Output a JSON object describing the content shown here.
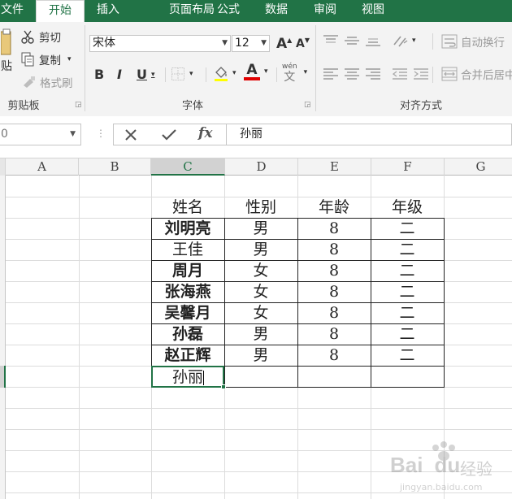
{
  "ribbon_tabs": [
    {
      "label": "文件",
      "active": false
    },
    {
      "label": "开始",
      "active": true
    },
    {
      "label": "插入",
      "active": false
    },
    {
      "label": "页面布局",
      "active": false
    },
    {
      "label": "公式",
      "active": false
    },
    {
      "label": "数据",
      "active": false
    },
    {
      "label": "审阅",
      "active": false
    },
    {
      "label": "视图",
      "active": false
    }
  ],
  "clipboard": {
    "paste_label": "贴",
    "cut_label": "剪切",
    "copy_label": "复制",
    "format_painter_label": "格式刷",
    "group_label": "剪贴板"
  },
  "font": {
    "name": "宋体",
    "size": "12",
    "bold": "B",
    "italic": "I",
    "underline": "U",
    "grow": "A",
    "shrink": "A",
    "color_glyph": "A",
    "wen_top": "wén",
    "wen_char": "文",
    "group_label": "字体"
  },
  "alignment": {
    "wrap_text_label": "自动换行",
    "merge_center_label": "合并后居中",
    "group_label": "对齐方式"
  },
  "formula_bar": {
    "name_box": "0",
    "fx": "fx",
    "content": "孙丽"
  },
  "columns": [
    "A",
    "B",
    "C",
    "D",
    "E",
    "F",
    "G"
  ],
  "selected_column": "C",
  "table": {
    "headers": [
      "姓名",
      "性别",
      "年龄",
      "年级"
    ],
    "rows": [
      [
        "刘明亮",
        "男",
        "8",
        "二"
      ],
      [
        "王佳",
        "男",
        "8",
        "二"
      ],
      [
        "周月",
        "女",
        "8",
        "二"
      ],
      [
        "张海燕",
        "女",
        "8",
        "二"
      ],
      [
        "吴馨月",
        "女",
        "8",
        "二"
      ],
      [
        "孙磊",
        "男",
        "8",
        "二"
      ],
      [
        "赵正辉",
        "男",
        "8",
        "二"
      ]
    ],
    "editing_cell_value": "孙丽"
  },
  "watermark": {
    "brand": "Bai",
    "brand2": "du",
    "suffix": "经验",
    "url": "jingyan.baidu.com"
  },
  "colors": {
    "accent": "#217346",
    "font_color_bar": "#e00000",
    "fill_color_bar": "#ffff00"
  }
}
